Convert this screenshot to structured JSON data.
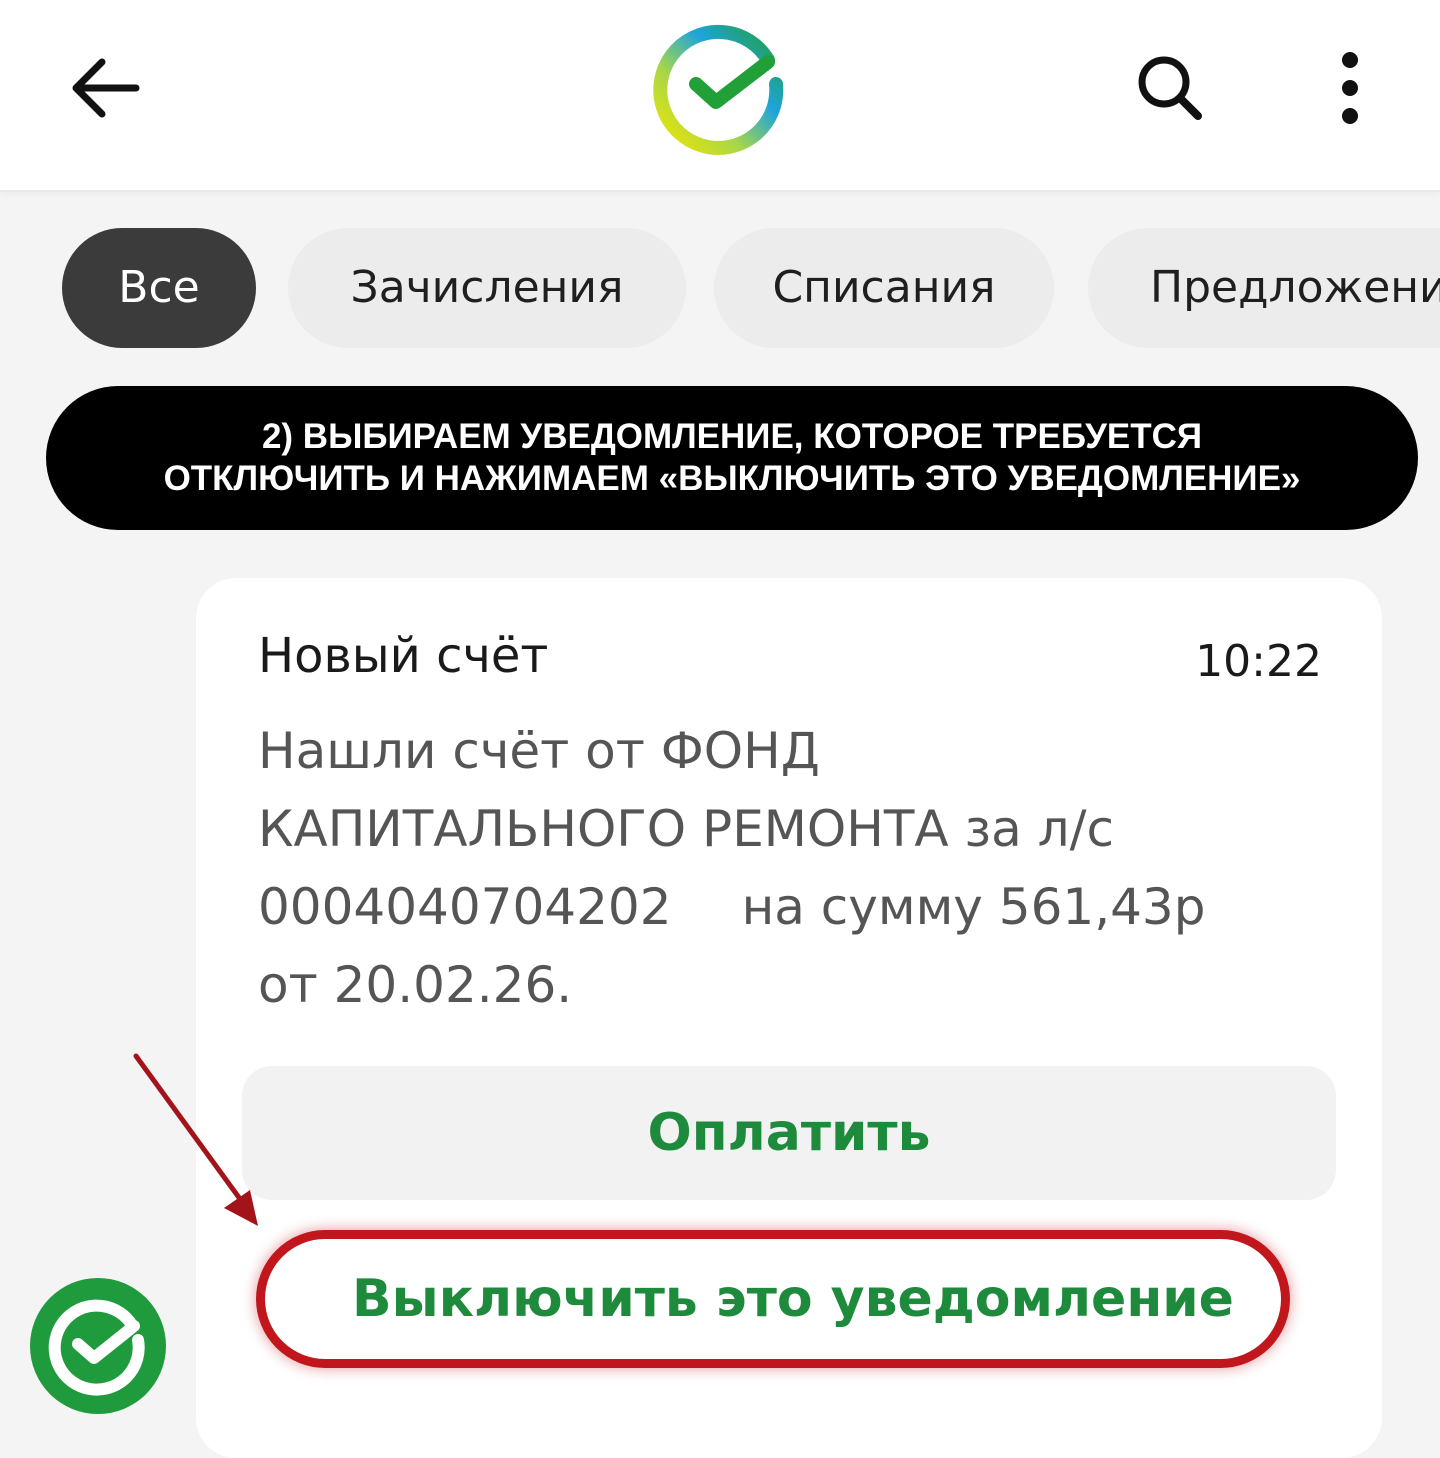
{
  "header": {
    "back_icon": "arrow-left-icon",
    "logo_icon": "sber-logo",
    "search_icon": "search-icon",
    "menu_icon": "more-vertical-icon"
  },
  "filters": {
    "selected": "Все",
    "items": [
      {
        "label": "Все"
      },
      {
        "label": "Зачисления"
      },
      {
        "label": "Списания"
      },
      {
        "label": "Предложени"
      }
    ]
  },
  "instruction": {
    "line1": "2) ВЫБИРАЕМ УВЕДОМЛЕНИЕ, КОТОРОЕ ТРЕБУЕТСЯ",
    "line2": "ОТКЛЮЧИТЬ И НАЖИМАЕМ «ВЫКЛЮЧИТЬ ЭТО УВЕДОМЛЕНИЕ»"
  },
  "notification": {
    "title": "Новый счёт",
    "time": "10:22",
    "body_line1": "Нашли счёт от ФОНД",
    "body_line2": "КАПИТАЛЬНОГО РЕМОНТА за л/с",
    "account": "0004040704202",
    "amount_text": "на сумму 561,43р",
    "date_text": "от 20.02.26."
  },
  "actions": {
    "pay_label": "Оплатить",
    "disable_label": "Выключить это уведомление"
  },
  "colors": {
    "accent_green": "#1e8a3c",
    "highlight_red": "#c0161c",
    "chip_active": "#3b3b3b"
  }
}
